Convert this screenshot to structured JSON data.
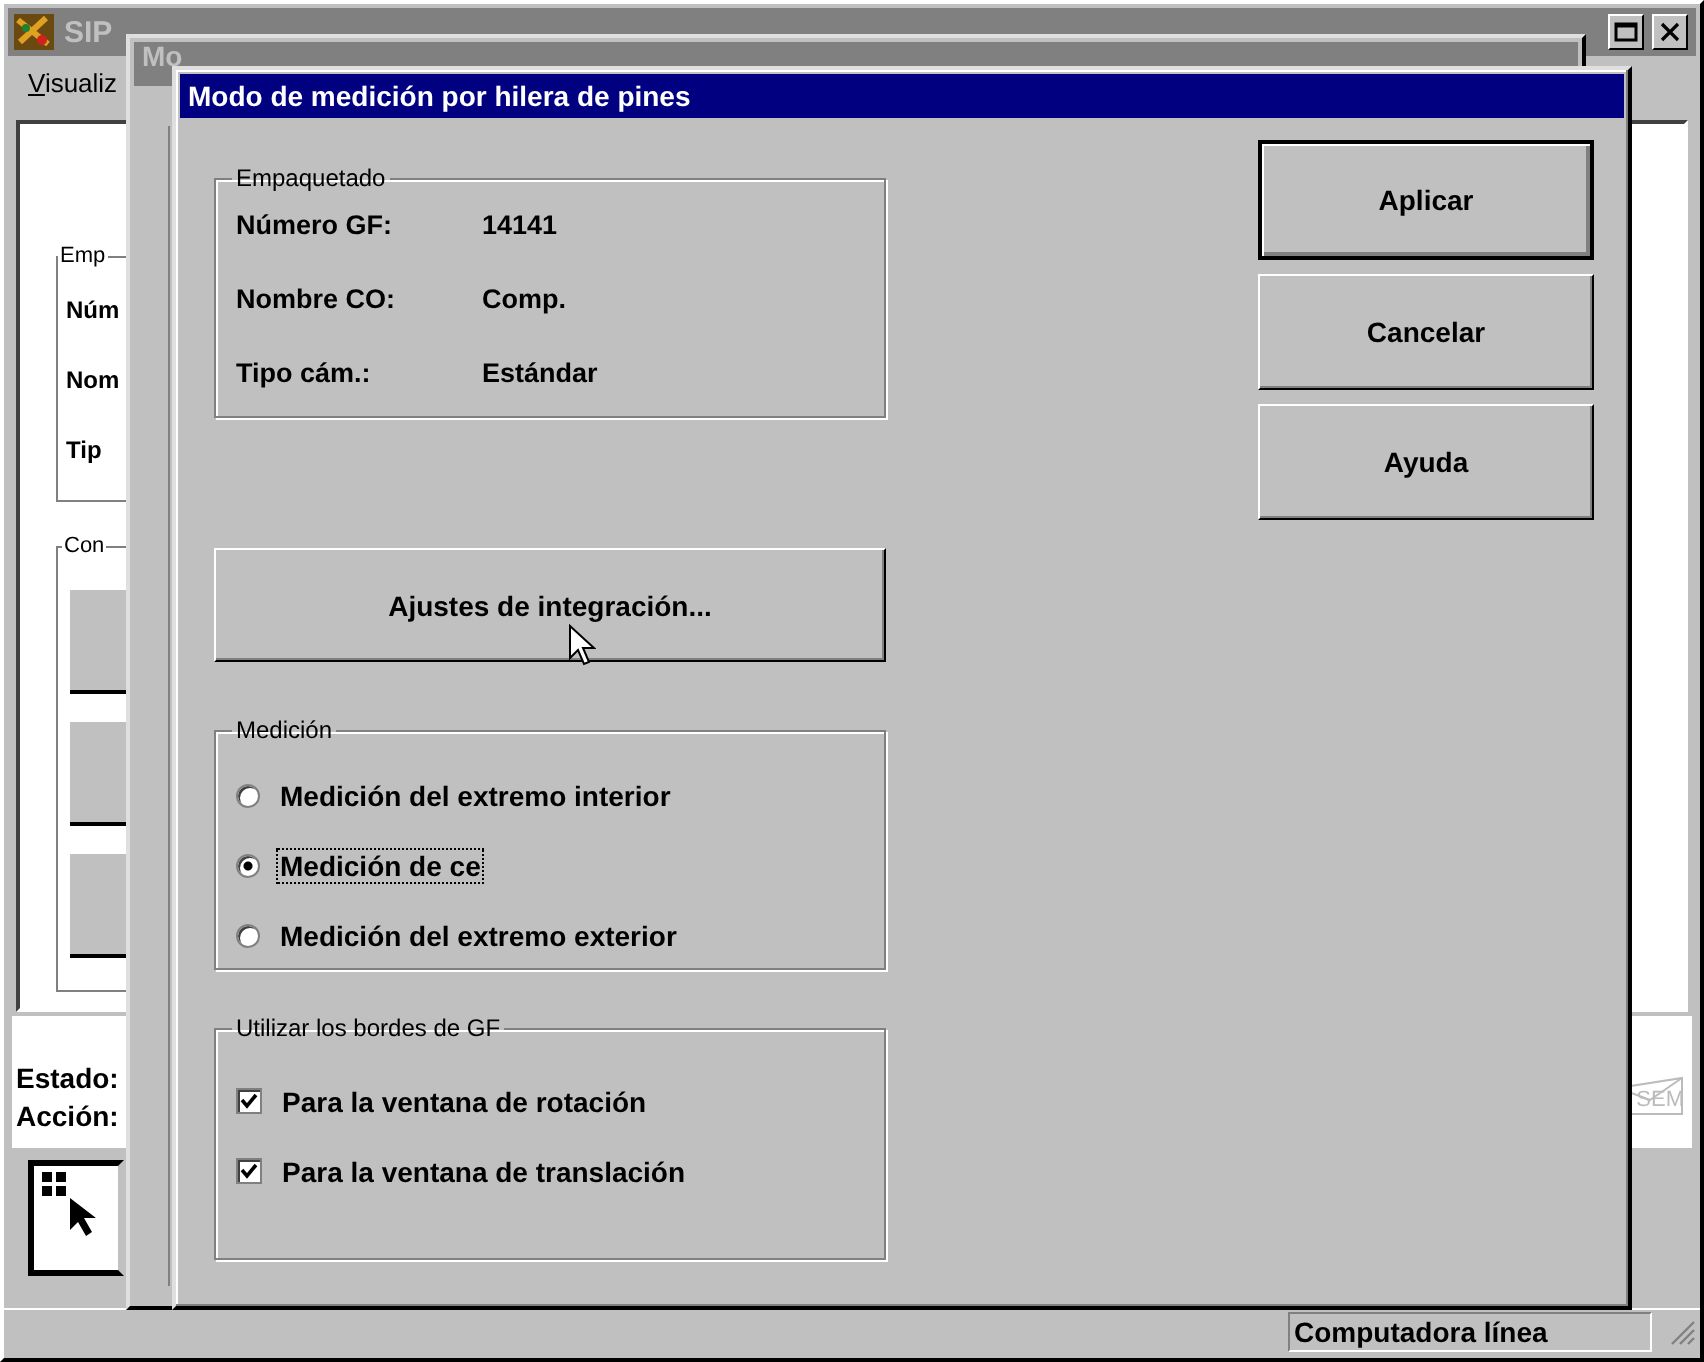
{
  "main_window": {
    "title": "SIP",
    "menu": [
      "Visualiz"
    ],
    "group_legends": [
      "Emp",
      "Con"
    ],
    "field_labels": [
      "Núm",
      "Nom",
      "Tip"
    ],
    "status_labels": [
      "Estado:",
      "Acción:"
    ],
    "indicator": "SEM",
    "status_bar": "Computadora línea"
  },
  "back_window": {
    "title": "Mo"
  },
  "dialog": {
    "title": "Modo de medición por hilera de pines",
    "package": {
      "legend": "Empaquetado",
      "rows": [
        {
          "label": "Número GF:",
          "value": "14141"
        },
        {
          "label": "Nombre CO:",
          "value": "Comp."
        },
        {
          "label": "Tipo cám.:",
          "value": "Estándar"
        }
      ]
    },
    "settings_button": "Ajustes de integración...",
    "measurement": {
      "legend": "Medición",
      "options": [
        {
          "label": "Medición del extremo interior",
          "selected": false
        },
        {
          "label": "Medición de ce",
          "selected": true
        },
        {
          "label": "Medición del extremo exterior",
          "selected": false
        }
      ]
    },
    "edges": {
      "legend": "Utilizar los bordes de GF",
      "options": [
        {
          "label": "Para la ventana de rotación",
          "checked": true
        },
        {
          "label": "Para la ventana de translación",
          "checked": true
        }
      ]
    },
    "buttons": [
      {
        "label": "Aplicar",
        "default": true
      },
      {
        "label": "Cancelar",
        "default": false
      },
      {
        "label": "Ayuda",
        "default": false
      }
    ]
  }
}
